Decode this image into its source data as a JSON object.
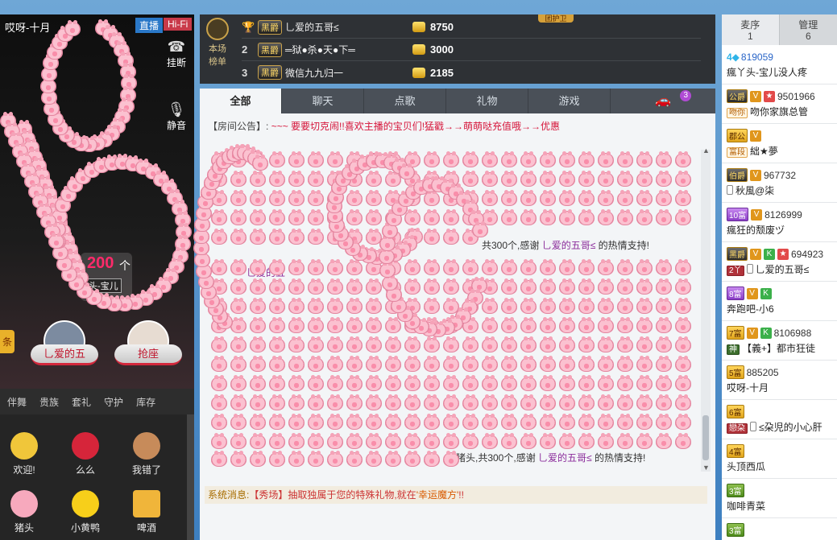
{
  "left_panel": {
    "anchor_name": "哎呀-十月",
    "badges": {
      "live": "直播",
      "hifi": "Hi-Fi"
    },
    "controls": {
      "hangup": "挂断",
      "mute": "静音"
    },
    "gift_count": "200",
    "gift_count_unit": "个",
    "gift_count_sub": "头-宝儿",
    "side_tag": "条",
    "seat_left_label": "乚爱的五",
    "seat_right_label": "抢座",
    "gift_tabs": [
      "伴舞",
      "贵族",
      "套礼",
      "守护",
      "库存"
    ],
    "gifts": [
      {
        "label": "欢迎!",
        "color": "#f0c63a"
      },
      {
        "label": "么么",
        "color": "#d6253a"
      },
      {
        "label": "我错了",
        "color": "#c78b5a"
      },
      {
        "label": "猪头",
        "color": "#f7a9bd"
      },
      {
        "label": "小黄鸭",
        "color": "#f7cf1a"
      },
      {
        "label": "啤酒",
        "color": "#f0b53a"
      }
    ]
  },
  "rank": {
    "crest_label": "本场榜单",
    "guard_label": "团护卫",
    "rows": [
      {
        "rank": "",
        "vip": "黑爵",
        "user": "乚爱的五哥≤",
        "score": "8750"
      },
      {
        "rank": "2",
        "vip": "黑爵",
        "user": "═狱●杀●天●下═",
        "score": "3000"
      },
      {
        "rank": "3",
        "vip": "黑爵",
        "user": "微信九九归一",
        "score": "2185"
      }
    ]
  },
  "chat": {
    "tabs": [
      "全部",
      "聊天",
      "点歌",
      "礼物",
      "游戏"
    ],
    "vehicle_notif": "3",
    "announcement_label": "【房间公告】:",
    "announcement_text": "~~~ 要要切克闹!!喜欢主播的宝贝们!猛戳→→萌萌哒充值哦→→优惠",
    "thanks_1": {
      "prefix": "共300个,感谢",
      "user": "乚爱的五哥≤",
      "suffix": "的热情支持!"
    },
    "mid_partial": "乚爱的五",
    "thanks_2": {
      "prefix": "猪头,共300个,感谢",
      "user": "乚爱的五哥≤",
      "suffix": "的热情支持!"
    },
    "system_label": "系统消息:",
    "system_text_1": "【秀场】抽取独属于您的特殊礼物,就在",
    "system_link": "'幸运魔方'",
    "system_text_2": "!!"
  },
  "users_panel": {
    "tabs": [
      {
        "label": "麦序",
        "count": "1"
      },
      {
        "label": "管理",
        "count": "6"
      }
    ],
    "users": [
      {
        "level": "4",
        "level_kind": "diamond",
        "id": "819059",
        "name": "瘋丫头-宝儿没人疼",
        "tags": []
      },
      {
        "level": "公爵",
        "level_kind": "dark",
        "id": "9501966",
        "name": "吻你家旗总管",
        "tags": [
          "吻你"
        ],
        "vip": [
          "V",
          "star"
        ]
      },
      {
        "level": "郡公",
        "level_kind": "gold",
        "id": "",
        "name": "絀★夢",
        "tags": [
          "富段"
        ],
        "vip": [
          "V"
        ]
      },
      {
        "level": "伯爵",
        "level_kind": "dark",
        "id": "967732",
        "name": "秋風@柒",
        "tags": [],
        "vip": [
          "V"
        ],
        "phone": true
      },
      {
        "level": "10富",
        "level_kind": "purple",
        "id": "8126999",
        "name": "瘋狂的颓废ヅ",
        "tags": [],
        "vip": [
          "V"
        ]
      },
      {
        "level": "黑爵",
        "level_kind": "dark",
        "id": "694923",
        "name": "乚爱的五哥≤",
        "tags": [
          "2丫"
        ],
        "vip": [
          "V",
          "K",
          "star"
        ],
        "phone": true
      },
      {
        "level": "8富",
        "level_kind": "purple",
        "id": "",
        "name": "奔跑吧-小6",
        "tags": [],
        "vip": [
          "V",
          "K"
        ]
      },
      {
        "level": "7富",
        "level_kind": "gold",
        "id": "8106988",
        "name": "【義+】都市狂徒",
        "tags": [
          "神"
        ],
        "vip": [
          "V",
          "K"
        ]
      },
      {
        "level": "5富",
        "level_kind": "gold",
        "id": "885205",
        "name": "哎呀-十月",
        "tags": []
      },
      {
        "level": "6富",
        "level_kind": "gold",
        "id": "",
        "name": "≤朶児的小心肝",
        "tags": [
          "戀朶"
        ],
        "phone": true
      },
      {
        "level": "4富",
        "level_kind": "gold",
        "id": "",
        "name": "头顶西瓜",
        "tags": []
      },
      {
        "level": "3富",
        "level_kind": "green",
        "id": "",
        "name": "咖啡青菜",
        "tags": []
      },
      {
        "level": "3富",
        "level_kind": "green",
        "id": "",
        "name": "",
        "tags": []
      }
    ]
  },
  "colors": {
    "accent": "#2a66c8",
    "vip_gold": "#e0a41c",
    "alert_red": "#d6153a",
    "pig_pink": "#fbc1d0"
  }
}
